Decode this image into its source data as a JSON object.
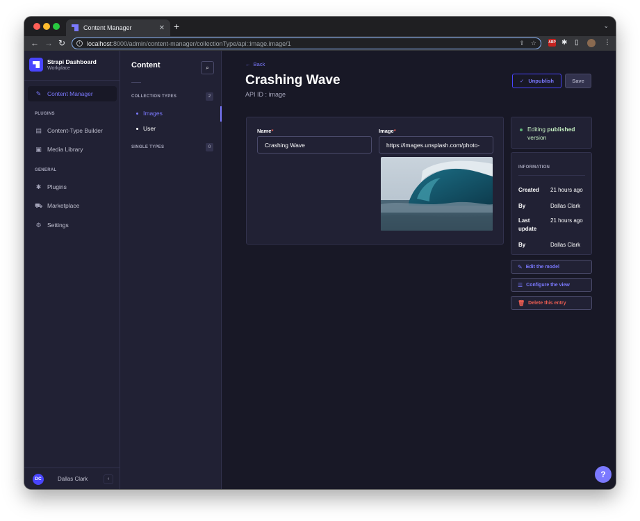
{
  "browser": {
    "tab_title": "Content Manager",
    "tab_close": "✕",
    "new_tab": "+",
    "url_host": "localhost",
    "url_rest": ":8000/admin/content-manager/collectionType/api::image.image/1",
    "extension_badge": "ABP"
  },
  "sidebar": {
    "brand_title": "Strapi Dashboard",
    "brand_subtitle": "Workplace",
    "content_manager": "Content Manager",
    "plugins_heading": "PLUGINS",
    "content_type_builder": "Content-Type Builder",
    "media_library": "Media Library",
    "general_heading": "GENERAL",
    "plugins": "Plugins",
    "marketplace": "Marketplace",
    "settings": "Settings",
    "user_initials": "DC",
    "user_name": "Dallas Clark"
  },
  "subnav": {
    "title": "Content",
    "collection_types": "COLLECTION TYPES",
    "collection_count": "2",
    "items": [
      "Images",
      "User"
    ],
    "single_types": "SINGLE TYPES",
    "single_count": "0"
  },
  "main": {
    "back": "Back",
    "title": "Crashing Wave",
    "api_id": "API ID : image",
    "unpublish": "Unpublish",
    "save": "Save",
    "name_label": "Name",
    "name_value": "Crashing Wave",
    "image_label": "Image",
    "image_value": "https://images.unsplash.com/photo-",
    "required_mark": "*"
  },
  "status": {
    "text_prefix": "Editing ",
    "text_bold": "published",
    "text_suffix": " version"
  },
  "info": {
    "heading": "INFORMATION",
    "created_label": "Created",
    "created_value": "21 hours ago",
    "by_label": "By",
    "by_value": "Dallas Clark",
    "updated_label": "Last update",
    "updated_value": "21 hours ago",
    "by2_label": "By",
    "by2_value": "Dallas Clark"
  },
  "actions": {
    "edit_model": "Edit the model",
    "configure_view": "Configure the view",
    "delete_entry": "Delete this entry"
  },
  "help": "?",
  "colors": {
    "primary": "#7b79ff",
    "brand": "#4945ff",
    "danger": "#ee5e52",
    "success": "#5cb176",
    "background": "#181826",
    "panel": "#212134"
  }
}
